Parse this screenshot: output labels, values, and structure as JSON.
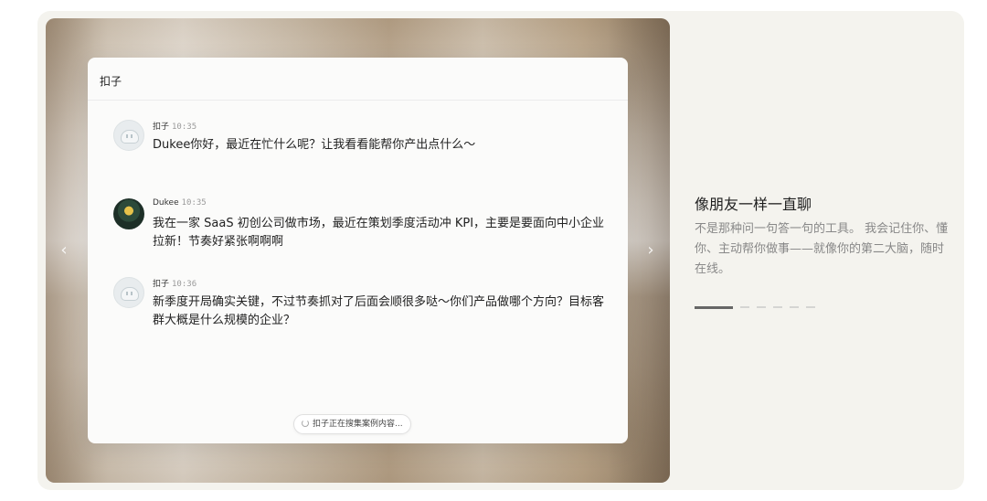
{
  "chat": {
    "title": "扣子",
    "messages": [
      {
        "sender": "扣子",
        "time": "10:35",
        "text": "Dukee你好，最近在忙什么呢？让我看看能帮你产出点什么～"
      },
      {
        "sender": "Dukee",
        "time": "10:35",
        "text": "我在一家 SaaS 初创公司做市场，最近在策划季度活动冲 KPI，主要是要面向中小企业拉新！节奏好紧张啊啊啊"
      },
      {
        "sender": "扣子",
        "time": "10:36",
        "text": "新季度开局确实关键，不过节奏抓对了后面会顺很多哒～你们产品做哪个方向？目标客群大概是什么规模的企业？"
      }
    ],
    "status": "扣子正在搜集案例内容..."
  },
  "carousel": {
    "prev_icon": "chevron-left-icon",
    "next_icon": "chevron-right-icon",
    "prev_glyph": "‹",
    "next_glyph": "›",
    "slide_count": 6,
    "active_index": 0
  },
  "side": {
    "title": "像朋友一样一直聊",
    "description": "不是那种问一句答一句的工具。 我会记住你、懂你、主动帮你做事——就像你的第二大脑，随时在线。"
  },
  "colors": {
    "panel_bg": "#f4f3ee",
    "chat_bg": "#fbfbfa",
    "desc_text": "#888888",
    "active_dot": "#666666"
  }
}
